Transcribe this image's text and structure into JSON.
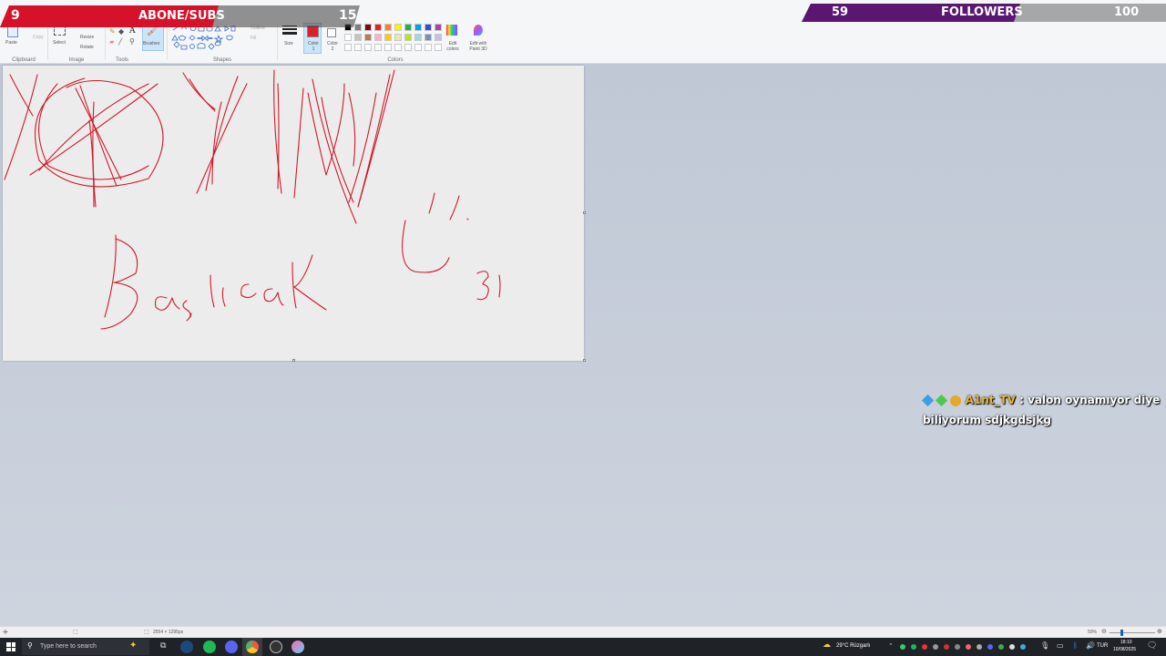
{
  "ribbon": {
    "clipboard": {
      "paste": "Paste",
      "copy": "Copy",
      "label": "Clipboard"
    },
    "image": {
      "select": "Select",
      "resize": "Resize",
      "rotate": "Rotate",
      "label": "Image"
    },
    "tools": {
      "label": "Tools"
    },
    "brushes": {
      "label": "Brushes"
    },
    "shapes": {
      "outline": "Outline",
      "fill": "Fill",
      "label": "Shapes"
    },
    "size": {
      "label": "Size"
    },
    "color1": {
      "label": "Color 1",
      "value": "#e11d2b"
    },
    "color2": {
      "label": "Color 2",
      "value": "#ffffff"
    },
    "colors": {
      "label": "Colors",
      "palette": [
        "#000000",
        "#7f7f7f",
        "#880015",
        "#ed1c24",
        "#ff7f27",
        "#fff200",
        "#22b14c",
        "#00a2e8",
        "#3f48cc",
        "#a349a4",
        "#ffffff",
        "#c3c3c3",
        "#b97a57",
        "#ffaec9",
        "#ffc90e",
        "#efe4b0",
        "#b5e61d",
        "#99d9ea",
        "#7092be",
        "#c8bfe7"
      ]
    },
    "edit_colors": "Edit colors",
    "edit_paint3d": "Edit with Paint 3D"
  },
  "canvas": {
    "handwriting": [
      "XOXO",
      "YIW",
      "Başlıcak",
      "3)"
    ]
  },
  "statusbar": {
    "dimensions": "2554 × 1295px",
    "zoom": "50%"
  },
  "overlay": {
    "subs": {
      "current": "9",
      "label": "ABONE/SUBS",
      "goal": "15",
      "progress": 0.6
    },
    "followers": {
      "current": "59",
      "label": "FOLLOWERS",
      "goal": "100",
      "progress": 0.59
    },
    "chat": {
      "user": "A1nt_TV",
      "sep": ":",
      "message": "valon oynamıyor diye biliyorum sdjkgdsjkg"
    }
  },
  "taskbar": {
    "search_placeholder": "Type here to search",
    "weather": "29°C  Rüzgarlı",
    "lang": "TUR",
    "time": "18:10",
    "date": "10/08/2025"
  }
}
